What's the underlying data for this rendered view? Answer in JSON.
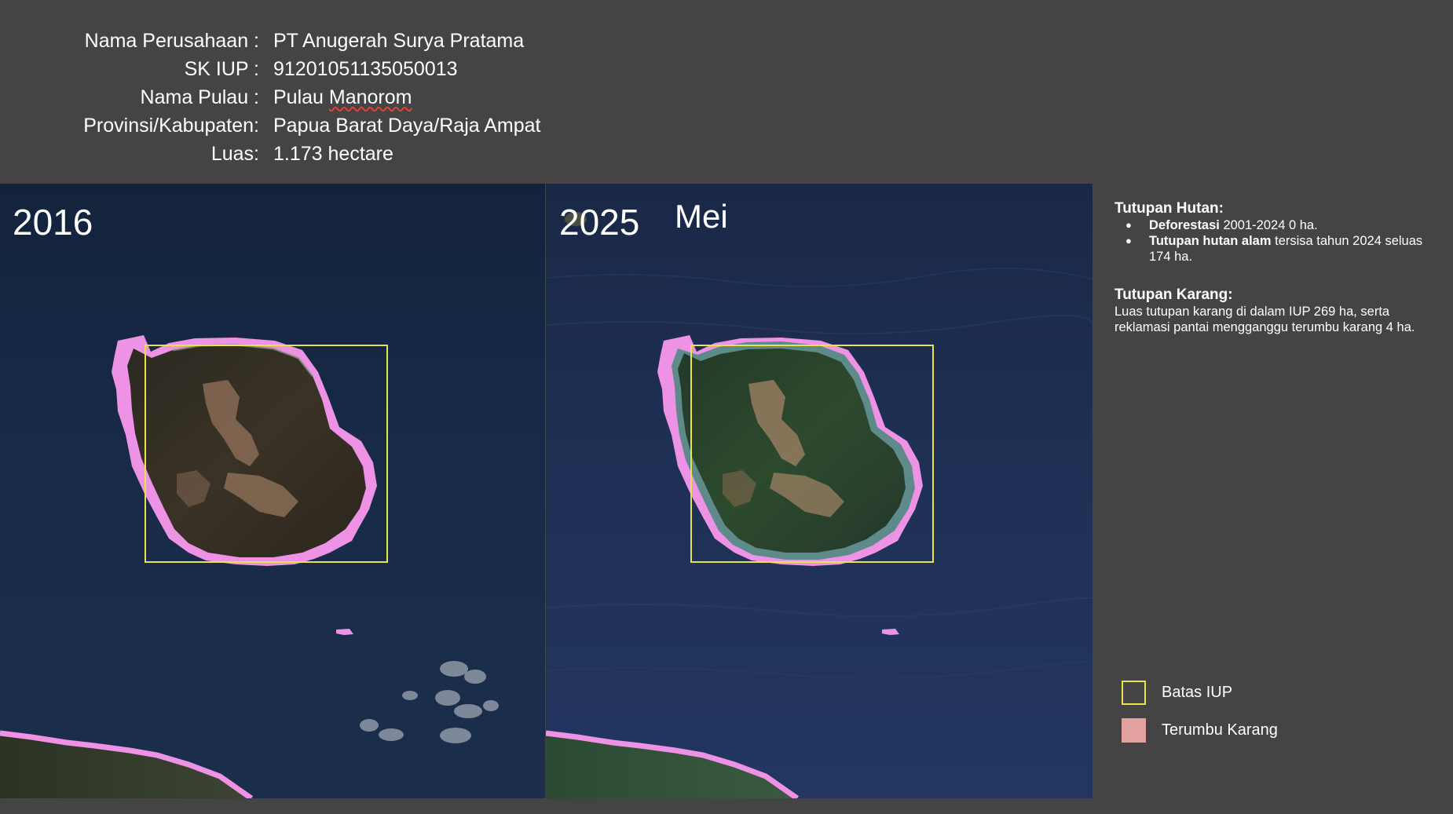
{
  "info": {
    "rows": [
      {
        "label": "Nama Perusahaan :",
        "value": "PT Anugerah Surya Pratama"
      },
      {
        "label": "SK IUP :",
        "value": "91201051135050013"
      },
      {
        "label": "Nama Pulau :",
        "value_prefix": "Pulau ",
        "value_flagged": "Manorom"
      },
      {
        "label": "Provinsi/Kabupaten:",
        "value": "Papua Barat Daya/Raja Ampat"
      },
      {
        "label": "Luas:",
        "value": "1.173 hectare"
      }
    ]
  },
  "maps": {
    "left": {
      "year": "2016"
    },
    "right": {
      "year": "2025",
      "month": "Mei"
    }
  },
  "side": {
    "forest_heading": "Tutupan Hutan:",
    "forest_bullets": [
      {
        "bold": "Deforestasi",
        "text": " 2001-2024 0 ha."
      },
      {
        "bold": "Tutupan hutan alam",
        "text": " tersisa tahun 2024 seluas 174 ha."
      }
    ],
    "coral_heading": "Tutupan Karang:",
    "coral_text": "Luas tutupan karang di dalam IUP 269 ha, serta reklamasi pantai mengganggu terumbu karang 4 ha."
  },
  "legend": {
    "items": [
      {
        "label": "Batas IUP",
        "color": "#e8e34a"
      },
      {
        "label": "Terumbu Karang",
        "color": "#e3a1a0"
      }
    ]
  },
  "colors": {
    "background": "#444444",
    "iup_boundary": "#e8e34a",
    "coral_overlay": "#ee92e6",
    "sea_2016": "#172a47",
    "sea_2025": "#1f3055"
  }
}
